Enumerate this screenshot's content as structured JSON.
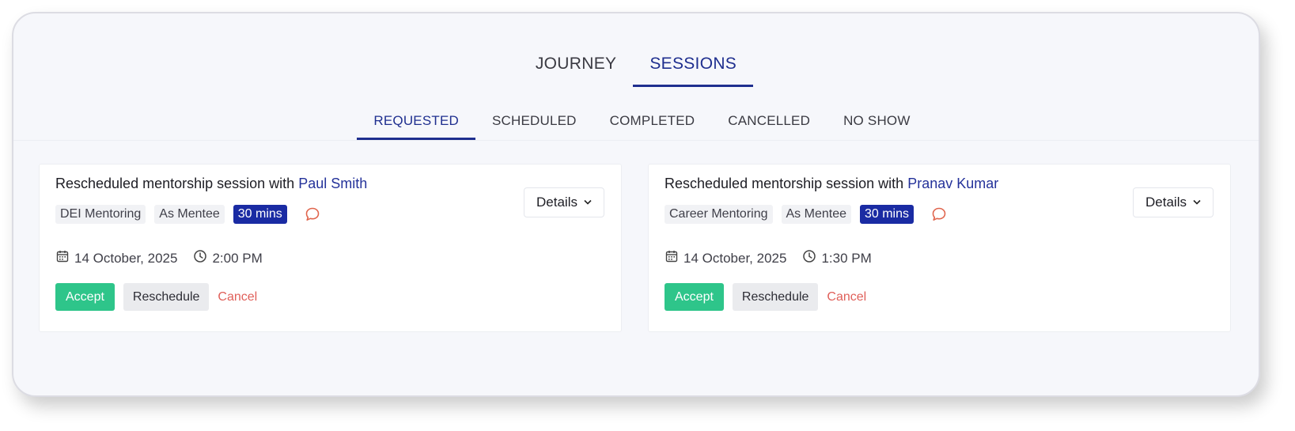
{
  "main_tabs": [
    {
      "label": "JOURNEY",
      "active": false
    },
    {
      "label": "SESSIONS",
      "active": true
    }
  ],
  "sub_tabs": [
    {
      "label": "REQUESTED",
      "active": true
    },
    {
      "label": "SCHEDULED",
      "active": false
    },
    {
      "label": "COMPLETED",
      "active": false
    },
    {
      "label": "CANCELLED",
      "active": false
    },
    {
      "label": "NO SHOW",
      "active": false
    }
  ],
  "colors": {
    "accent": "#1f2f8f",
    "duration_badge": "#1a2ba3",
    "accept": "#2ec58a",
    "cancel": "#e0605a",
    "chat_icon": "#e0654d"
  },
  "sessions": [
    {
      "title_prefix": "Rescheduled mentorship session with",
      "person": "Paul Smith",
      "details_label": "Details",
      "tags": [
        "DEI Mentoring",
        "As Mentee"
      ],
      "duration": "30 mins",
      "date": "14 October, 2025",
      "time": "2:00 PM",
      "accept_label": "Accept",
      "reschedule_label": "Reschedule",
      "cancel_label": "Cancel"
    },
    {
      "title_prefix": "Rescheduled mentorship session with",
      "person": "Pranav Kumar",
      "details_label": "Details",
      "tags": [
        "Career Mentoring",
        "As Mentee"
      ],
      "duration": "30 mins",
      "date": "14 October, 2025",
      "time": "1:30 PM",
      "accept_label": "Accept",
      "reschedule_label": "Reschedule",
      "cancel_label": "Cancel"
    }
  ],
  "icons": {
    "calendar": "calendar-icon",
    "clock": "clock-icon",
    "chat": "chat-bubble-icon",
    "chevron": "chevron-down-icon"
  }
}
